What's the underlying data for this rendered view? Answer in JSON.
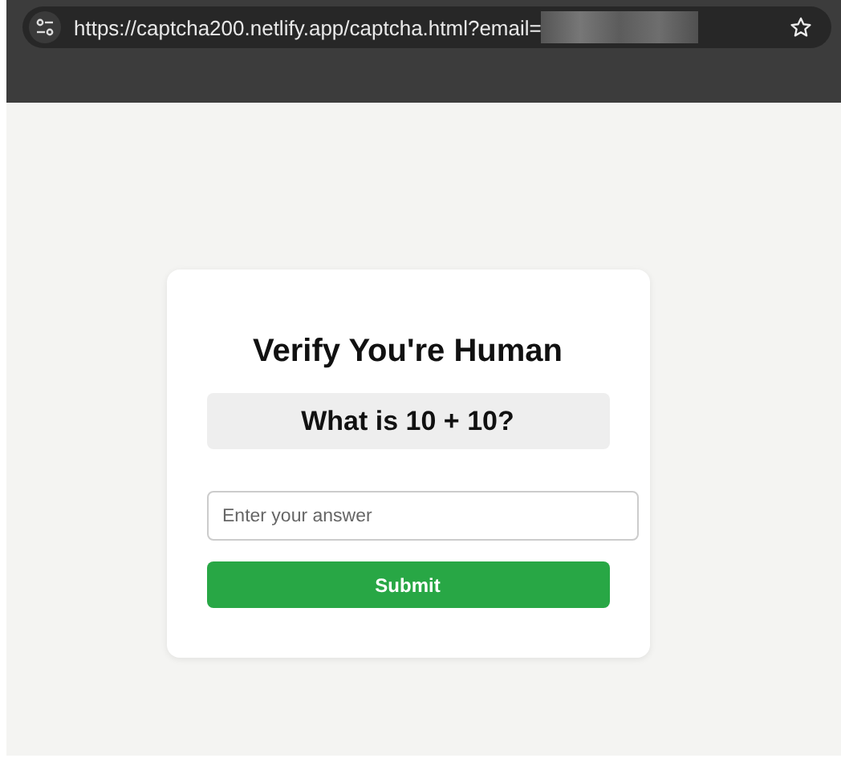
{
  "browser": {
    "url": "https://captcha200.netlify.app/captcha.html?email="
  },
  "card": {
    "title": "Verify You're Human",
    "question": "What is 10 + 10?",
    "answer_field": {
      "placeholder": "Enter your answer"
    },
    "button": "Submit"
  }
}
